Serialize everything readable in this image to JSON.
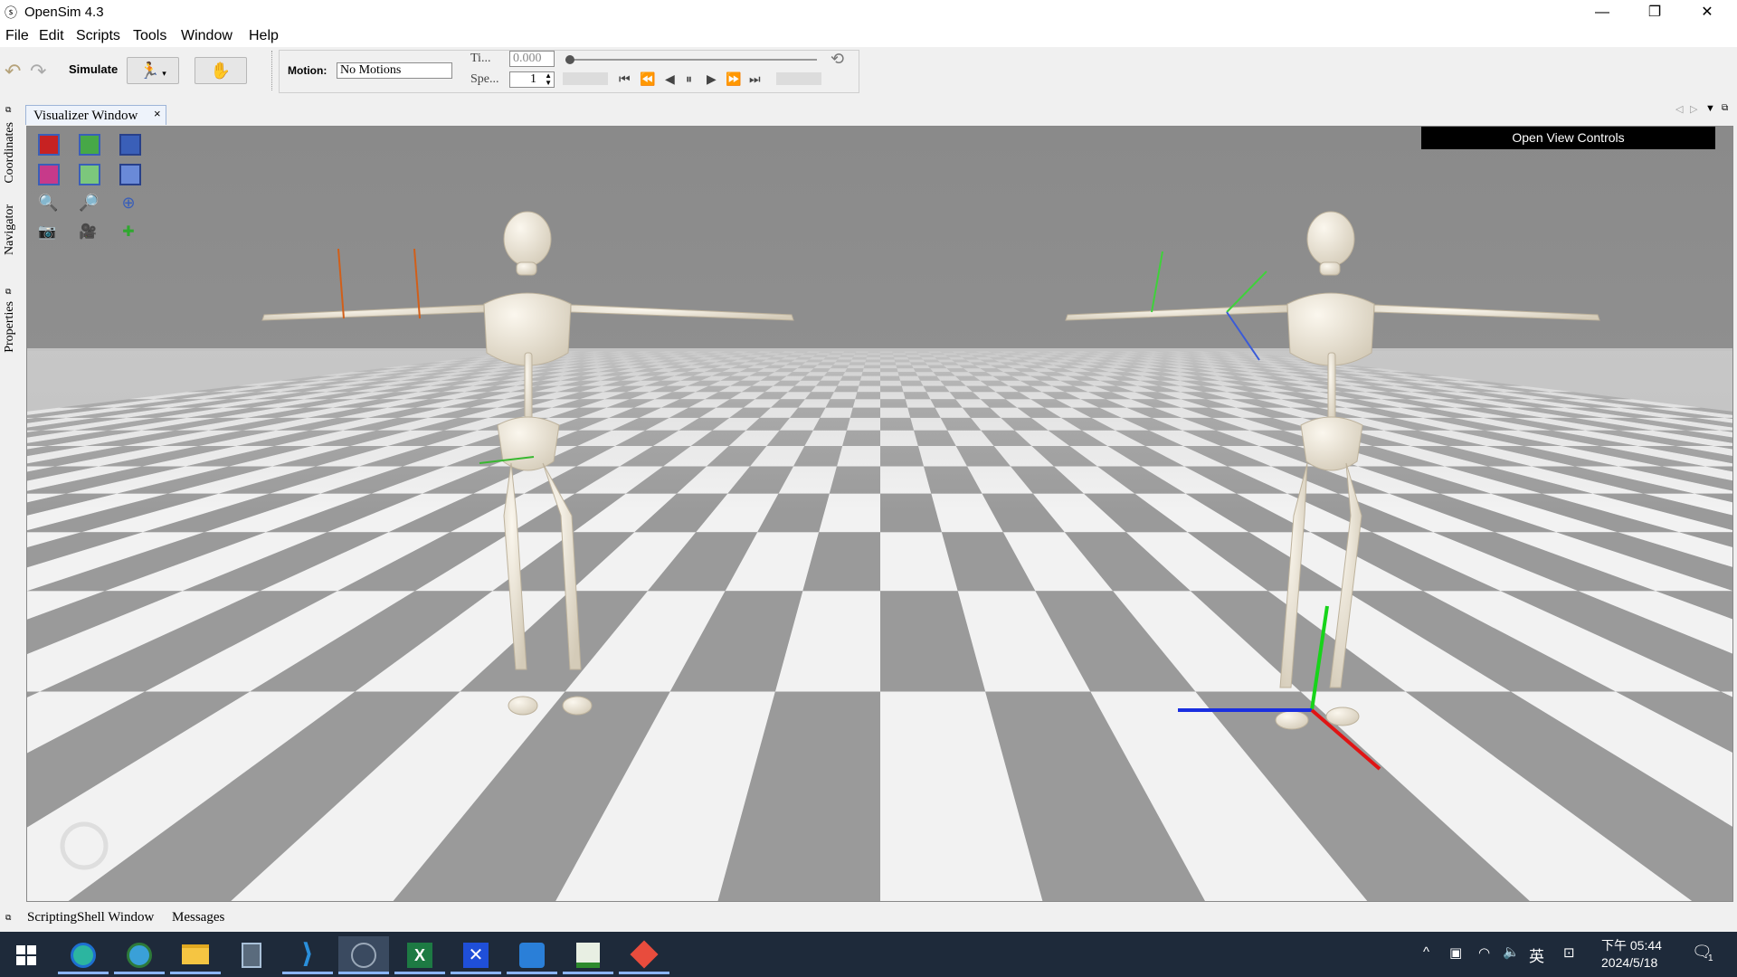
{
  "window": {
    "title": "OpenSim 4.3",
    "icon": "opensim-logo-icon"
  },
  "menu": [
    "File",
    "Edit",
    "Scripts",
    "Tools",
    "Window",
    "Help"
  ],
  "toolbar": {
    "simulate_label": "Simulate",
    "motion_label": "Motion:",
    "motion_value": "No Motions",
    "time_label": "Ti...",
    "time_value": "0.000",
    "speed_label": "Spe...",
    "speed_value": "1"
  },
  "side_tabs": [
    "Coordinates",
    "Navigator",
    "Properties"
  ],
  "viz_tab": {
    "label": "Visualizer Window",
    "close": "×"
  },
  "viewport": {
    "open_view_controls": "Open View Controls"
  },
  "bottom_tabs": [
    "ScriptingShell Window",
    "Messages"
  ],
  "taskbar": {
    "ime": "英",
    "time": "下午 05:44",
    "date": "2024/5/18",
    "notifications": "1"
  },
  "colors": {
    "sky": "#8c8c8c",
    "floor_dark": "#9a9a9a",
    "floor_light": "#f2f2f2",
    "taskbar": "#1e2a3a"
  }
}
